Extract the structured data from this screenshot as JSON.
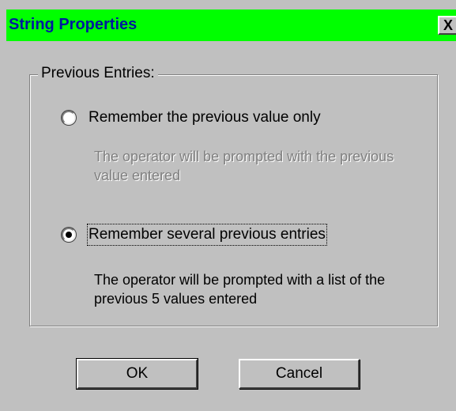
{
  "window": {
    "title": "String Properties",
    "close_label": "X",
    "title_bar_color": "#00ff00",
    "title_text_color": "#001a9e"
  },
  "group": {
    "legend": "Previous Entries:"
  },
  "options": [
    {
      "label": "Remember the previous value only",
      "selected": false,
      "description": "The operator will be prompted with the previous value entered",
      "description_enabled": false
    },
    {
      "label": "Remember several previous entries",
      "selected": true,
      "description": "The operator will be prompted with a list of the previous 5 values entered",
      "description_enabled": true
    }
  ],
  "buttons": {
    "ok_label": "OK",
    "cancel_label": "Cancel"
  }
}
